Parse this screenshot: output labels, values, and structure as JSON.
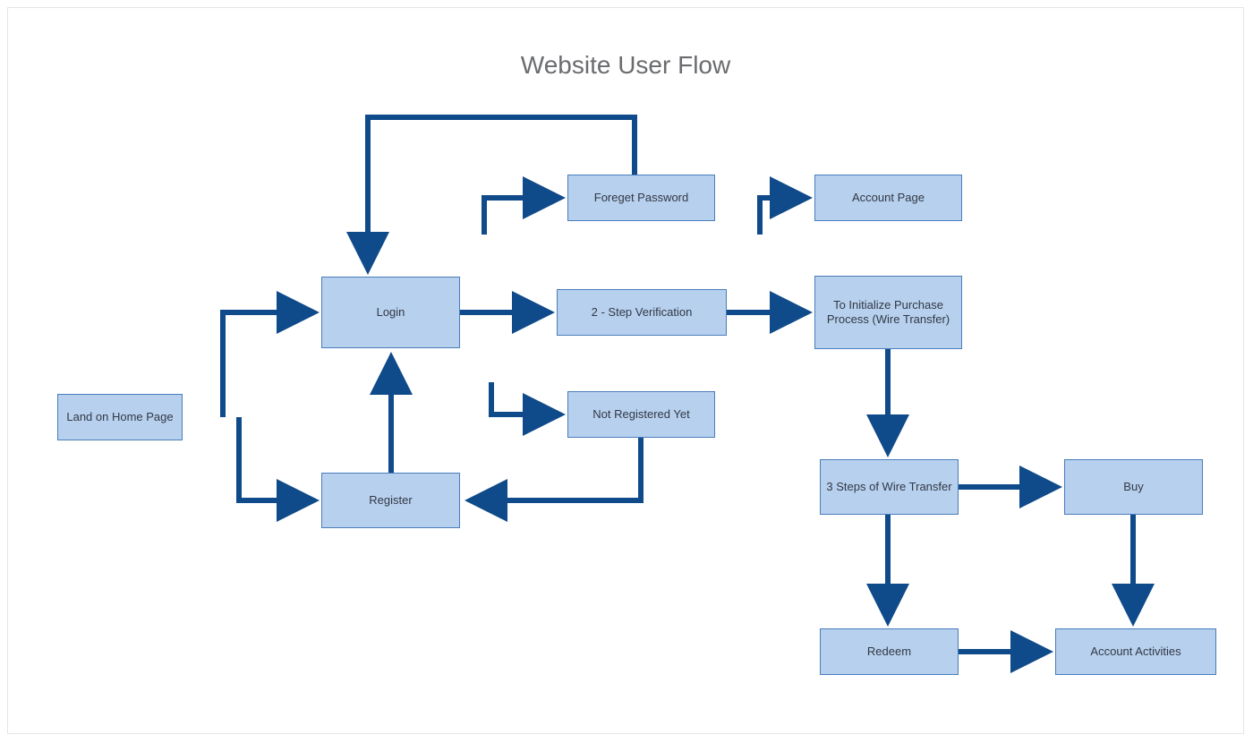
{
  "title": "Website User Flow",
  "colors": {
    "node_fill": "#b6d0ee",
    "node_border": "#4a7dbb",
    "arrow": "#0f4a8a",
    "title_text": "#6a6c6f"
  },
  "nodes": {
    "home": {
      "label": "Land on Home Page"
    },
    "login": {
      "label": "Login"
    },
    "register": {
      "label": "Register"
    },
    "forgot": {
      "label": "Foreget Password"
    },
    "twostep": {
      "label": "2 - Step Verification"
    },
    "notreg": {
      "label": "Not Registered Yet"
    },
    "account_page": {
      "label": "Account Page"
    },
    "init_purchase": {
      "label": "To Initialize Purchase Process (Wire Transfer)"
    },
    "wire3": {
      "label": "3 Steps of Wire Transfer"
    },
    "buy": {
      "label": "Buy"
    },
    "redeem": {
      "label": "Redeem"
    },
    "activities": {
      "label": "Account Activities"
    }
  },
  "edges": [
    {
      "from": "home",
      "to": "login"
    },
    {
      "from": "home",
      "to": "register"
    },
    {
      "from": "register",
      "to": "login"
    },
    {
      "from": "login",
      "to": "twostep"
    },
    {
      "from": "login",
      "to": "forgot"
    },
    {
      "from": "login",
      "to": "notreg"
    },
    {
      "from": "forgot",
      "to": "login"
    },
    {
      "from": "notreg",
      "to": "register"
    },
    {
      "from": "twostep",
      "to": "init_purchase"
    },
    {
      "from": "forgot",
      "to": "account_page"
    },
    {
      "from": "init_purchase",
      "to": "wire3"
    },
    {
      "from": "wire3",
      "to": "buy"
    },
    {
      "from": "wire3",
      "to": "redeem"
    },
    {
      "from": "buy",
      "to": "activities"
    },
    {
      "from": "redeem",
      "to": "activities"
    }
  ]
}
